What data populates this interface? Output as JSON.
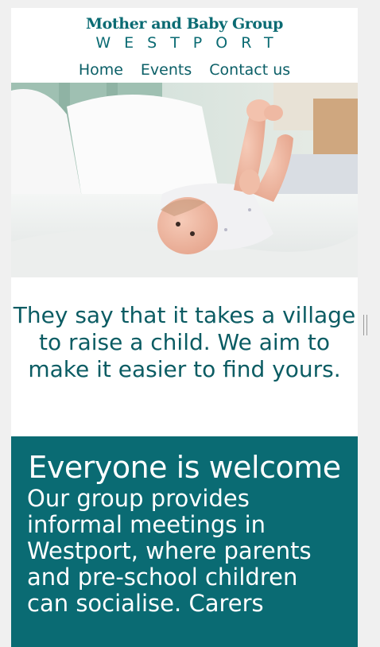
{
  "header": {
    "title": "Mother and Baby Group",
    "subtitle": "WESTPORT"
  },
  "nav": {
    "items": [
      "Home",
      "Events",
      "Contact us"
    ]
  },
  "hero": {
    "image": "baby-lying-on-bed-photo"
  },
  "intro": {
    "quote": "They say that it takes a village to raise a child. We aim to make it easier to find yours."
  },
  "welcome": {
    "heading": "Everyone is welcome",
    "body": "Our group provides informal meetings in Westport, where parents and pre-school children can socialise. Carers"
  },
  "colors": {
    "brand": "#0b6b73",
    "welcome_bg": "#0a6b73"
  }
}
